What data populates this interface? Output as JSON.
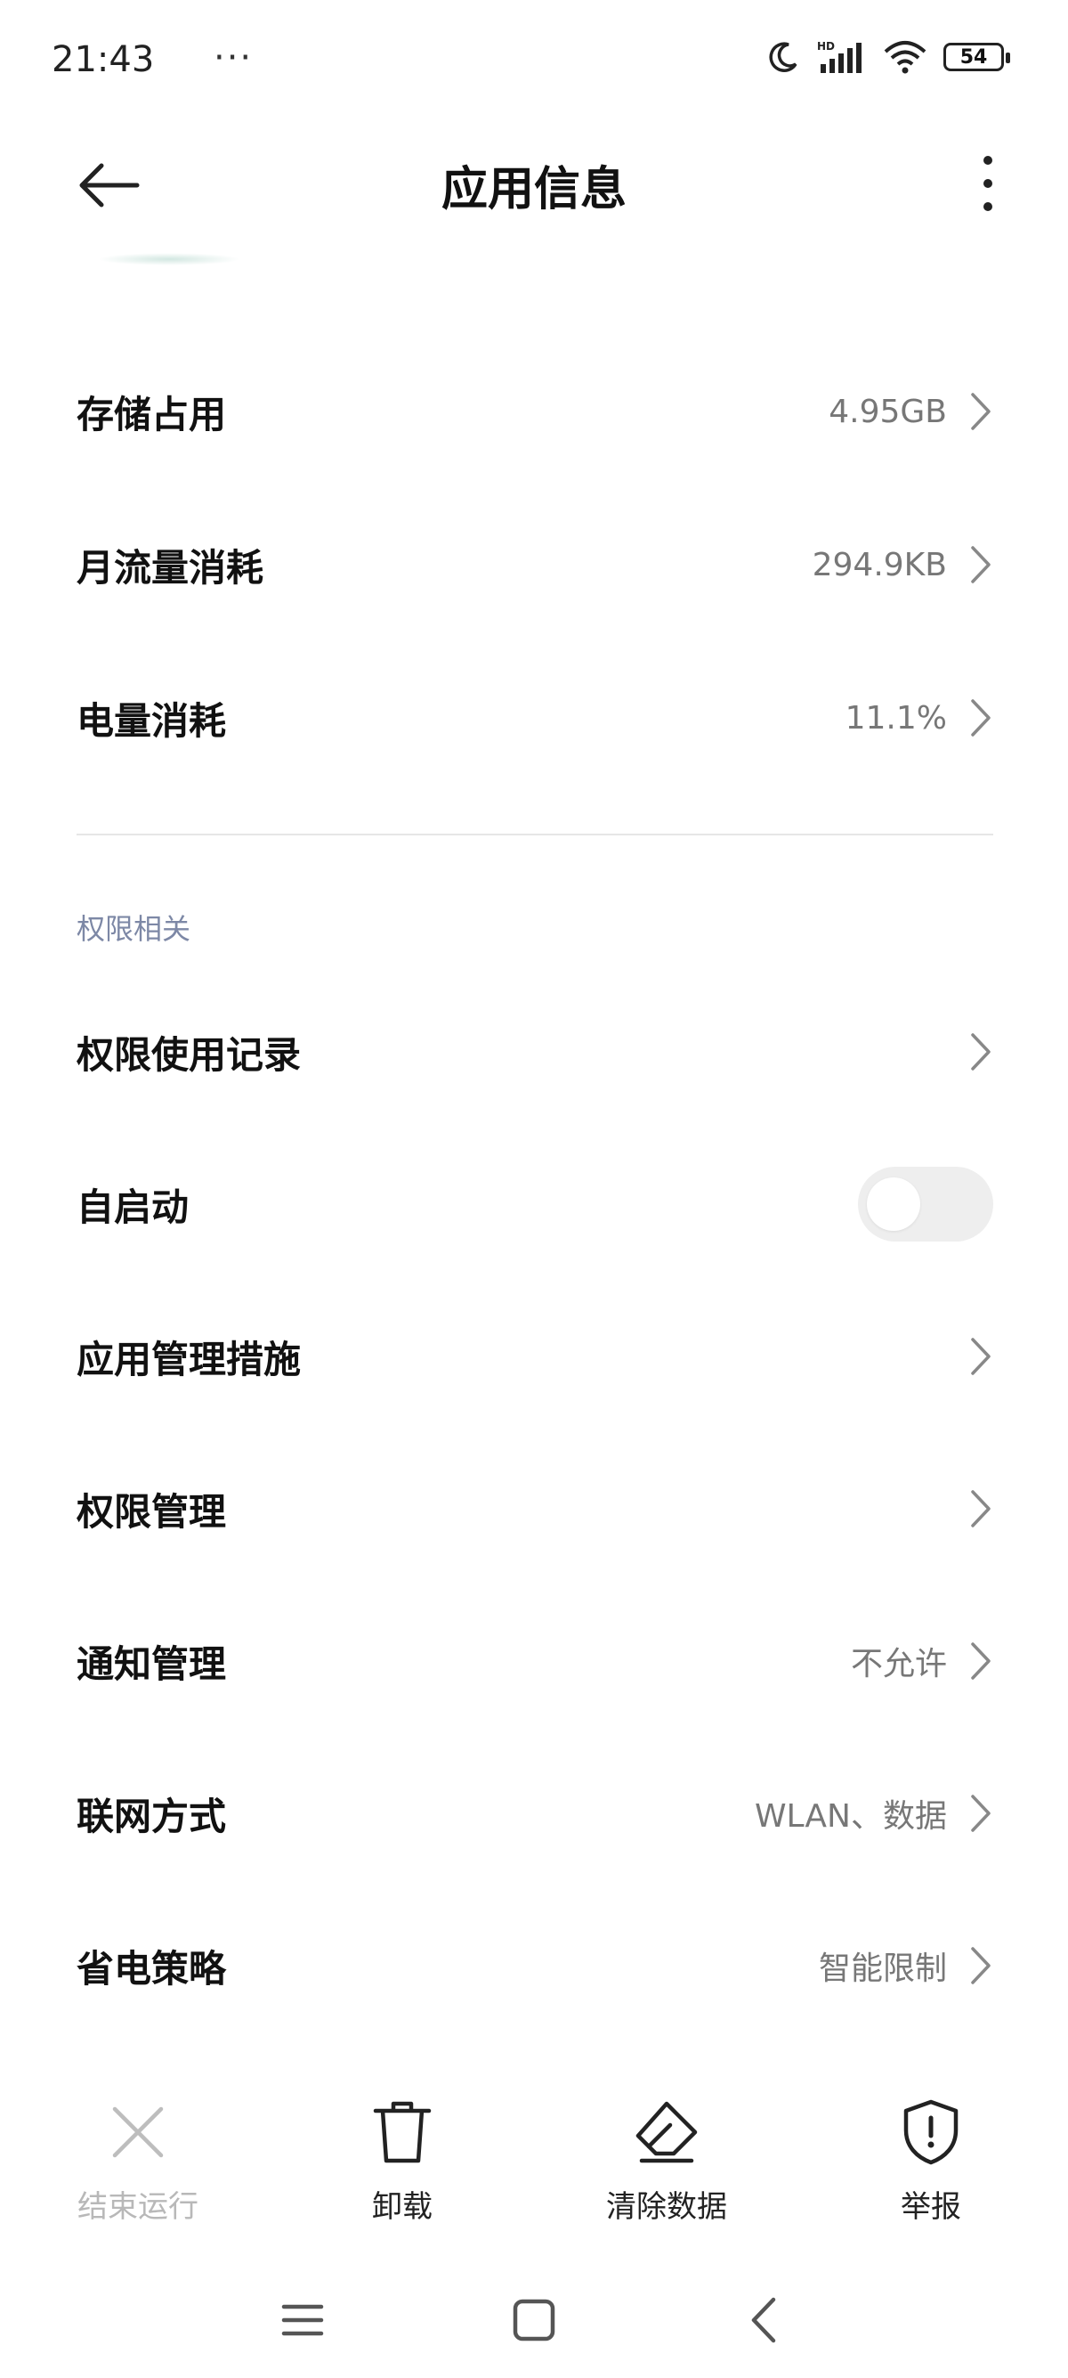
{
  "status_bar": {
    "time": "21:43",
    "dots": "···",
    "battery": "54",
    "network": "HD"
  },
  "header": {
    "title": "应用信息"
  },
  "usage": {
    "storage": {
      "label": "存储占用",
      "value": "4.95GB"
    },
    "data": {
      "label": "月流量消耗",
      "value": "294.9KB"
    },
    "battery": {
      "label": "电量消耗",
      "value": "11.1%"
    }
  },
  "permissions": {
    "section_title": "权限相关",
    "items": [
      {
        "label": "权限使用记录",
        "value": ""
      },
      {
        "label": "自启动",
        "toggle": false
      },
      {
        "label": "应用管理措施",
        "value": ""
      },
      {
        "label": "权限管理",
        "value": ""
      },
      {
        "label": "通知管理",
        "value": "不允许"
      },
      {
        "label": "联网方式",
        "value": "WLAN、数据"
      },
      {
        "label": "省电策略",
        "value": "智能限制"
      }
    ]
  },
  "actions": {
    "force_stop": "结束运行",
    "uninstall": "卸载",
    "clear_data": "清除数据",
    "report": "举报"
  },
  "colors": {
    "accent_section": "#7d88a6",
    "text_primary": "#111111",
    "text_secondary": "#777777",
    "disabled": "#b8b8b8"
  }
}
